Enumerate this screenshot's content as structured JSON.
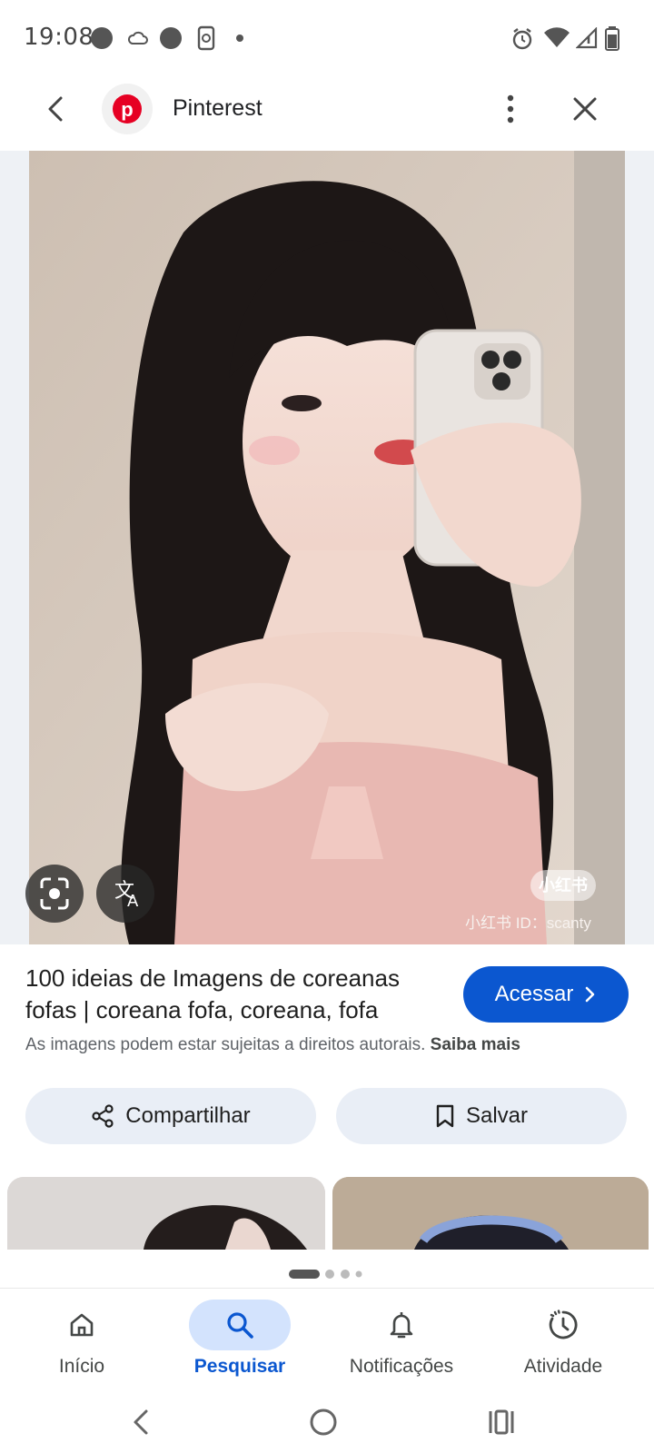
{
  "status": {
    "time": "19:08",
    "icons": [
      "notification-dot-icon",
      "cloud-icon",
      "notification-dot-icon",
      "phone-sync-icon",
      "more-dot-icon",
      "alarm-icon",
      "wifi-icon",
      "signal-icon",
      "battery-icon"
    ]
  },
  "topbar": {
    "back_icon": "chevron-left-icon",
    "site_icon": "pinterest-logo",
    "title": "Pinterest",
    "menu_icon": "more-vert-icon",
    "close_icon": "close-icon"
  },
  "image": {
    "watermark_badge": "小红书",
    "watermark_text": "小红书 ID：scanty",
    "lens_icon": "lens-icon",
    "translate_icon": "translate-icon"
  },
  "result": {
    "title": "100 ideias de Imagens de coreanas fofas | coreana fofa, coreana, fofa",
    "visit_label": "Acessar",
    "copyright_text": "As imagens podem estar sujeitas a direitos autorais.",
    "learn_more": "Saiba mais"
  },
  "actions": {
    "share_label": "Compartilhar",
    "save_label": "Salvar"
  },
  "pager": {
    "pages": 4,
    "active": 0
  },
  "bottom_nav": {
    "items": [
      {
        "label": "Início",
        "icon": "home-icon",
        "active": false
      },
      {
        "label": "Pesquisar",
        "icon": "search-icon",
        "active": true
      },
      {
        "label": "Notificações",
        "icon": "bell-icon",
        "active": false
      },
      {
        "label": "Atividade",
        "icon": "activity-icon",
        "active": false
      }
    ]
  },
  "colors": {
    "accent": "#0b57d0",
    "active_nav_bg": "#d3e3fd",
    "pill_bg": "#e9eef6",
    "pinterest_red": "#e60023"
  }
}
